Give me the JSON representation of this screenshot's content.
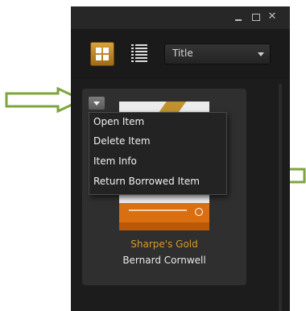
{
  "window": {
    "controls": {
      "minimize_icon": "minimize-icon",
      "maximize_icon": "maximize-icon",
      "close_icon": "close-icon",
      "close_glyph": "✕"
    }
  },
  "toolbar": {
    "grid_view_icon": "grid-view-icon",
    "list_view_icon": "list-view-icon",
    "sort": {
      "selected": "Title",
      "caret_icon": "chevron-down-icon"
    }
  },
  "book": {
    "title": "Sharpe's Gold",
    "author": "Bernard Cornwell"
  },
  "context_menu": {
    "items": [
      {
        "label": "Open Item"
      },
      {
        "label": "Delete Item"
      },
      {
        "label": "Item Info"
      },
      {
        "label": "Return Borrowed Item"
      }
    ]
  },
  "colors": {
    "accent": "#d89a2a",
    "annotation_arrow": "#7ea53b",
    "app_background": "#1c1c1c"
  }
}
